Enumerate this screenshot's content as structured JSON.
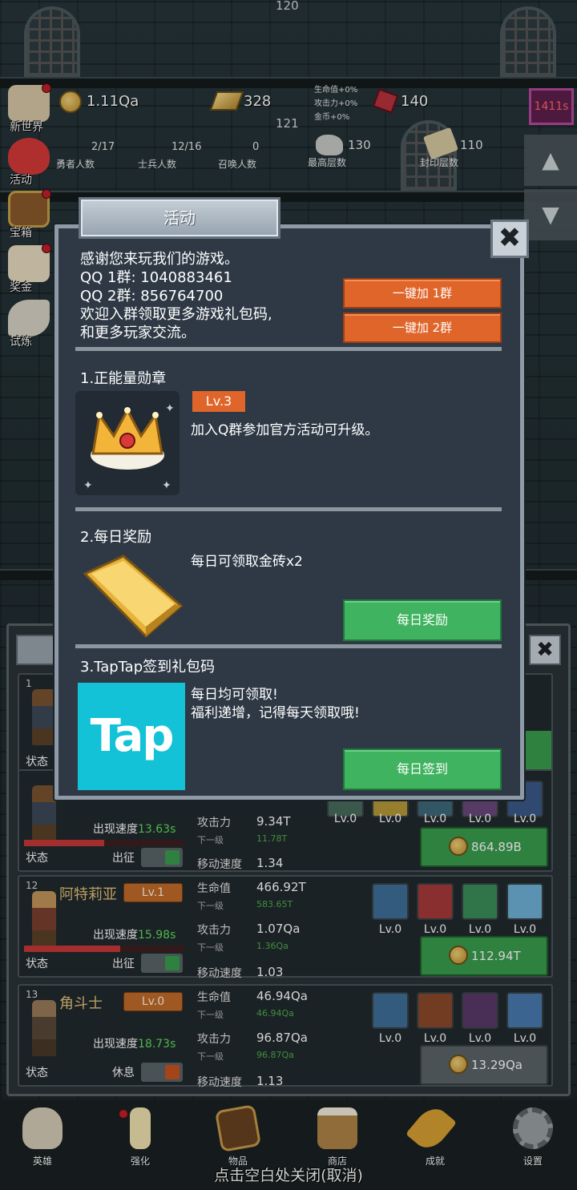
{
  "top": {
    "floor_top": "120",
    "floor_mid": "121"
  },
  "resources": {
    "gold": "1.11Qa",
    "gold_bar": "328",
    "gem": "140",
    "bonus": [
      "生命值+0%",
      "攻击力+0%",
      "金币+0%"
    ],
    "timer": "1411s"
  },
  "stats": [
    {
      "value": "2/17",
      "label": "勇者人数"
    },
    {
      "value": "12/16",
      "label": "士兵人数"
    },
    {
      "value": "0",
      "label": "召唤人数"
    },
    {
      "value": "130",
      "label": "最高层数"
    },
    {
      "value": "110",
      "label": "封印层数"
    }
  ],
  "side_menu": [
    {
      "label": "新世界",
      "icon": "map-icon"
    },
    {
      "label": "活动",
      "icon": "heart-icon"
    },
    {
      "label": "宝箱",
      "icon": "chest-icon"
    },
    {
      "label": "奖金",
      "icon": "letter-icon"
    },
    {
      "label": "试炼",
      "icon": "feather-icon"
    }
  ],
  "dialog": {
    "title": "活动",
    "intro": [
      "感谢您来玩我们的游戏。",
      "QQ 1群: 1040883461",
      "QQ 2群: 856764700",
      "欢迎入群领取更多游戏礼包码,",
      "和更多玩家交流。"
    ],
    "join1": "一键加 1群",
    "join2": "一键加 2群",
    "sec1": {
      "title": "1.正能量勋章",
      "level": "Lv.3",
      "desc": "加入Q群参加官方活动可升级。"
    },
    "sec2": {
      "title": "2.每日奖励",
      "desc": "每日可领取金砖x2",
      "button": "每日奖励"
    },
    "sec3": {
      "title": "3.TapTap签到礼包码",
      "desc": [
        "每日均可领取!",
        "福利递增，记得每天领取哦!"
      ],
      "logo": "Tap",
      "button": "每日签到"
    }
  },
  "heroes": {
    "card1": {
      "idx": "1",
      "state": "状态"
    },
    "card2": {
      "speed_label": "出现速度",
      "speed": "13.63s",
      "state": "状态",
      "march": "出征",
      "hp_fraction": 0.5,
      "atk_label": "攻击力",
      "atk": "9.34T",
      "atk_next_label": "下一级",
      "atk_next": "11.78T",
      "move_label": "移动速度",
      "move": "1.34",
      "skills": [
        "Lv.0",
        "Lv.0",
        "Lv.0",
        "Lv.0",
        "Lv.0"
      ],
      "cost": "864.89B"
    },
    "card3": {
      "idx": "12",
      "name": "阿特莉亚",
      "level": "Lv.1",
      "speed_label": "出现速度",
      "speed": "15.98s",
      "state": "状态",
      "march": "出征",
      "hp_fraction": 0.6,
      "hp_label": "生命值",
      "hp": "466.92T",
      "hp_next_label": "下一级",
      "hp_next": "583.65T",
      "atk_label": "攻击力",
      "atk": "1.07Qa",
      "atk_next_label": "下一级",
      "atk_next": "1.36Qa",
      "move_label": "移动速度",
      "move": "1.03",
      "skills": [
        "Lv.0",
        "Lv.0",
        "Lv.0",
        "Lv.0"
      ],
      "cost": "112.94T"
    },
    "card4": {
      "idx": "13",
      "name": "角斗士",
      "level": "Lv.0",
      "speed_label": "出现速度",
      "speed": "18.73s",
      "state": "状态",
      "rest": "休息",
      "hp_label": "生命值",
      "hp": "46.94Qa",
      "hp_next_label": "下一级",
      "hp_next": "46.94Qa",
      "atk_label": "攻击力",
      "atk": "96.87Qa",
      "atk_next_label": "下一级",
      "atk_next": "96.87Qa",
      "move_label": "移动速度",
      "move": "1.13",
      "skills": [
        "Lv.0",
        "Lv.0",
        "Lv.0",
        "Lv.0"
      ],
      "cost": "13.29Qa"
    }
  },
  "nav": [
    {
      "label": "英雄",
      "icon": "skull-icon"
    },
    {
      "label": "强化",
      "icon": "candle-icon"
    },
    {
      "label": "物品",
      "icon": "book-icon"
    },
    {
      "label": "商店",
      "icon": "mug-icon"
    },
    {
      "label": "成就",
      "icon": "key-icon"
    },
    {
      "label": "设置",
      "icon": "gear-icon"
    }
  ],
  "close_hint": "点击空白处关闭(取消)",
  "colors": {
    "accent_orange": "#e0652a",
    "accent_green": "#3fb35f",
    "dialog_bg": "#2e3945"
  }
}
